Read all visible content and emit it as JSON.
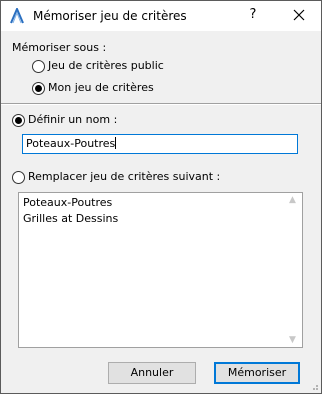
{
  "window": {
    "title": "Mémoriser jeu de critères",
    "help_symbol": "?"
  },
  "save_under": {
    "label": "Mémoriser sous :",
    "options": [
      {
        "label": "Jeu de critères public",
        "checked": false
      },
      {
        "label": "Mon jeu de critères",
        "checked": true
      }
    ]
  },
  "define_name": {
    "label": "Définir un nom :",
    "checked": true,
    "value": "Poteaux-Poutres"
  },
  "replace": {
    "label": "Remplacer jeu de critères suivant :",
    "checked": false,
    "items": [
      "Poteaux-Poutres",
      "Grilles at Dessins"
    ]
  },
  "buttons": {
    "cancel": "Annuler",
    "save": "Mémoriser"
  },
  "colors": {
    "focus": "#0078d7",
    "brand_icon": "#2a6fc0"
  }
}
